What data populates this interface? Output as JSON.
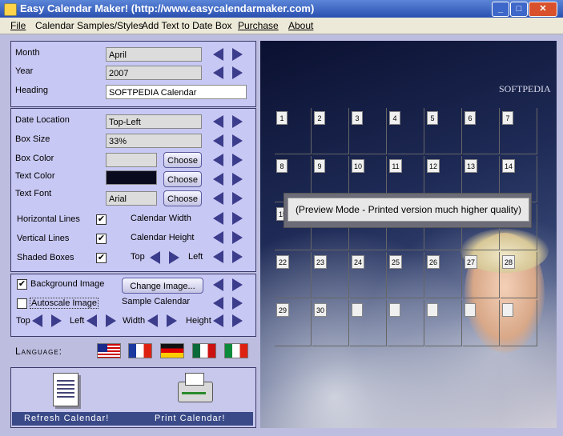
{
  "window": {
    "title": "Easy Calendar Maker! (http://www.easycalendarmaker.com)"
  },
  "menu": [
    "File",
    "Calendar Samples/Styles",
    "Add Text to Date Box",
    "Purchase",
    "About"
  ],
  "panel1": {
    "month_label": "Month",
    "month_value": "April",
    "year_label": "Year",
    "year_value": "2007",
    "heading_label": "Heading",
    "heading_value": "SOFTPEDIA Calendar"
  },
  "panel2": {
    "date_location_label": "Date Location",
    "date_location_value": "Top-Left",
    "box_size_label": "Box Size",
    "box_size_value": "33%",
    "box_color_label": "Box Color",
    "text_color_label": "Text Color",
    "text_font_label": "Text Font",
    "text_font_value": "Arial",
    "choose": "Choose",
    "horizontal_lines": "Horizontal Lines",
    "vertical_lines": "Vertical Lines",
    "shaded_boxes": "Shaded Boxes",
    "calendar_width": "Calendar Width",
    "calendar_height": "Calendar Height",
    "top": "Top",
    "left": "Left"
  },
  "panel3": {
    "background_image": "Background Image",
    "change_image": "Change Image...",
    "autoscale_image": "Autoscale Image",
    "sample_calendar": "Sample Calendar",
    "top": "Top",
    "left": "Left",
    "width": "Width",
    "height": "Height"
  },
  "language": {
    "label": "Language:",
    "flags": [
      "us-flag-icon",
      "france-flag-icon",
      "germany-flag-icon",
      "mexico-flag-icon",
      "italy-flag-icon"
    ]
  },
  "actions": {
    "refresh": "Refresh Calendar!",
    "print": "Print Calendar!"
  },
  "preview": {
    "brand": "SOFTPEDIA",
    "notice": "(Preview Mode - Printed version much higher quality)",
    "days": [
      "1",
      "2",
      "3",
      "4",
      "5",
      "6",
      "7",
      "8",
      "9",
      "10",
      "11",
      "12",
      "13",
      "14",
      "15",
      "22",
      "23",
      "24",
      "25",
      "26",
      "27",
      "28",
      "29",
      "30"
    ]
  },
  "colors": {
    "panel": "#c8c8f4",
    "arrow": "#3c3c8c",
    "text_color_swatch": "#0a0a1e"
  }
}
